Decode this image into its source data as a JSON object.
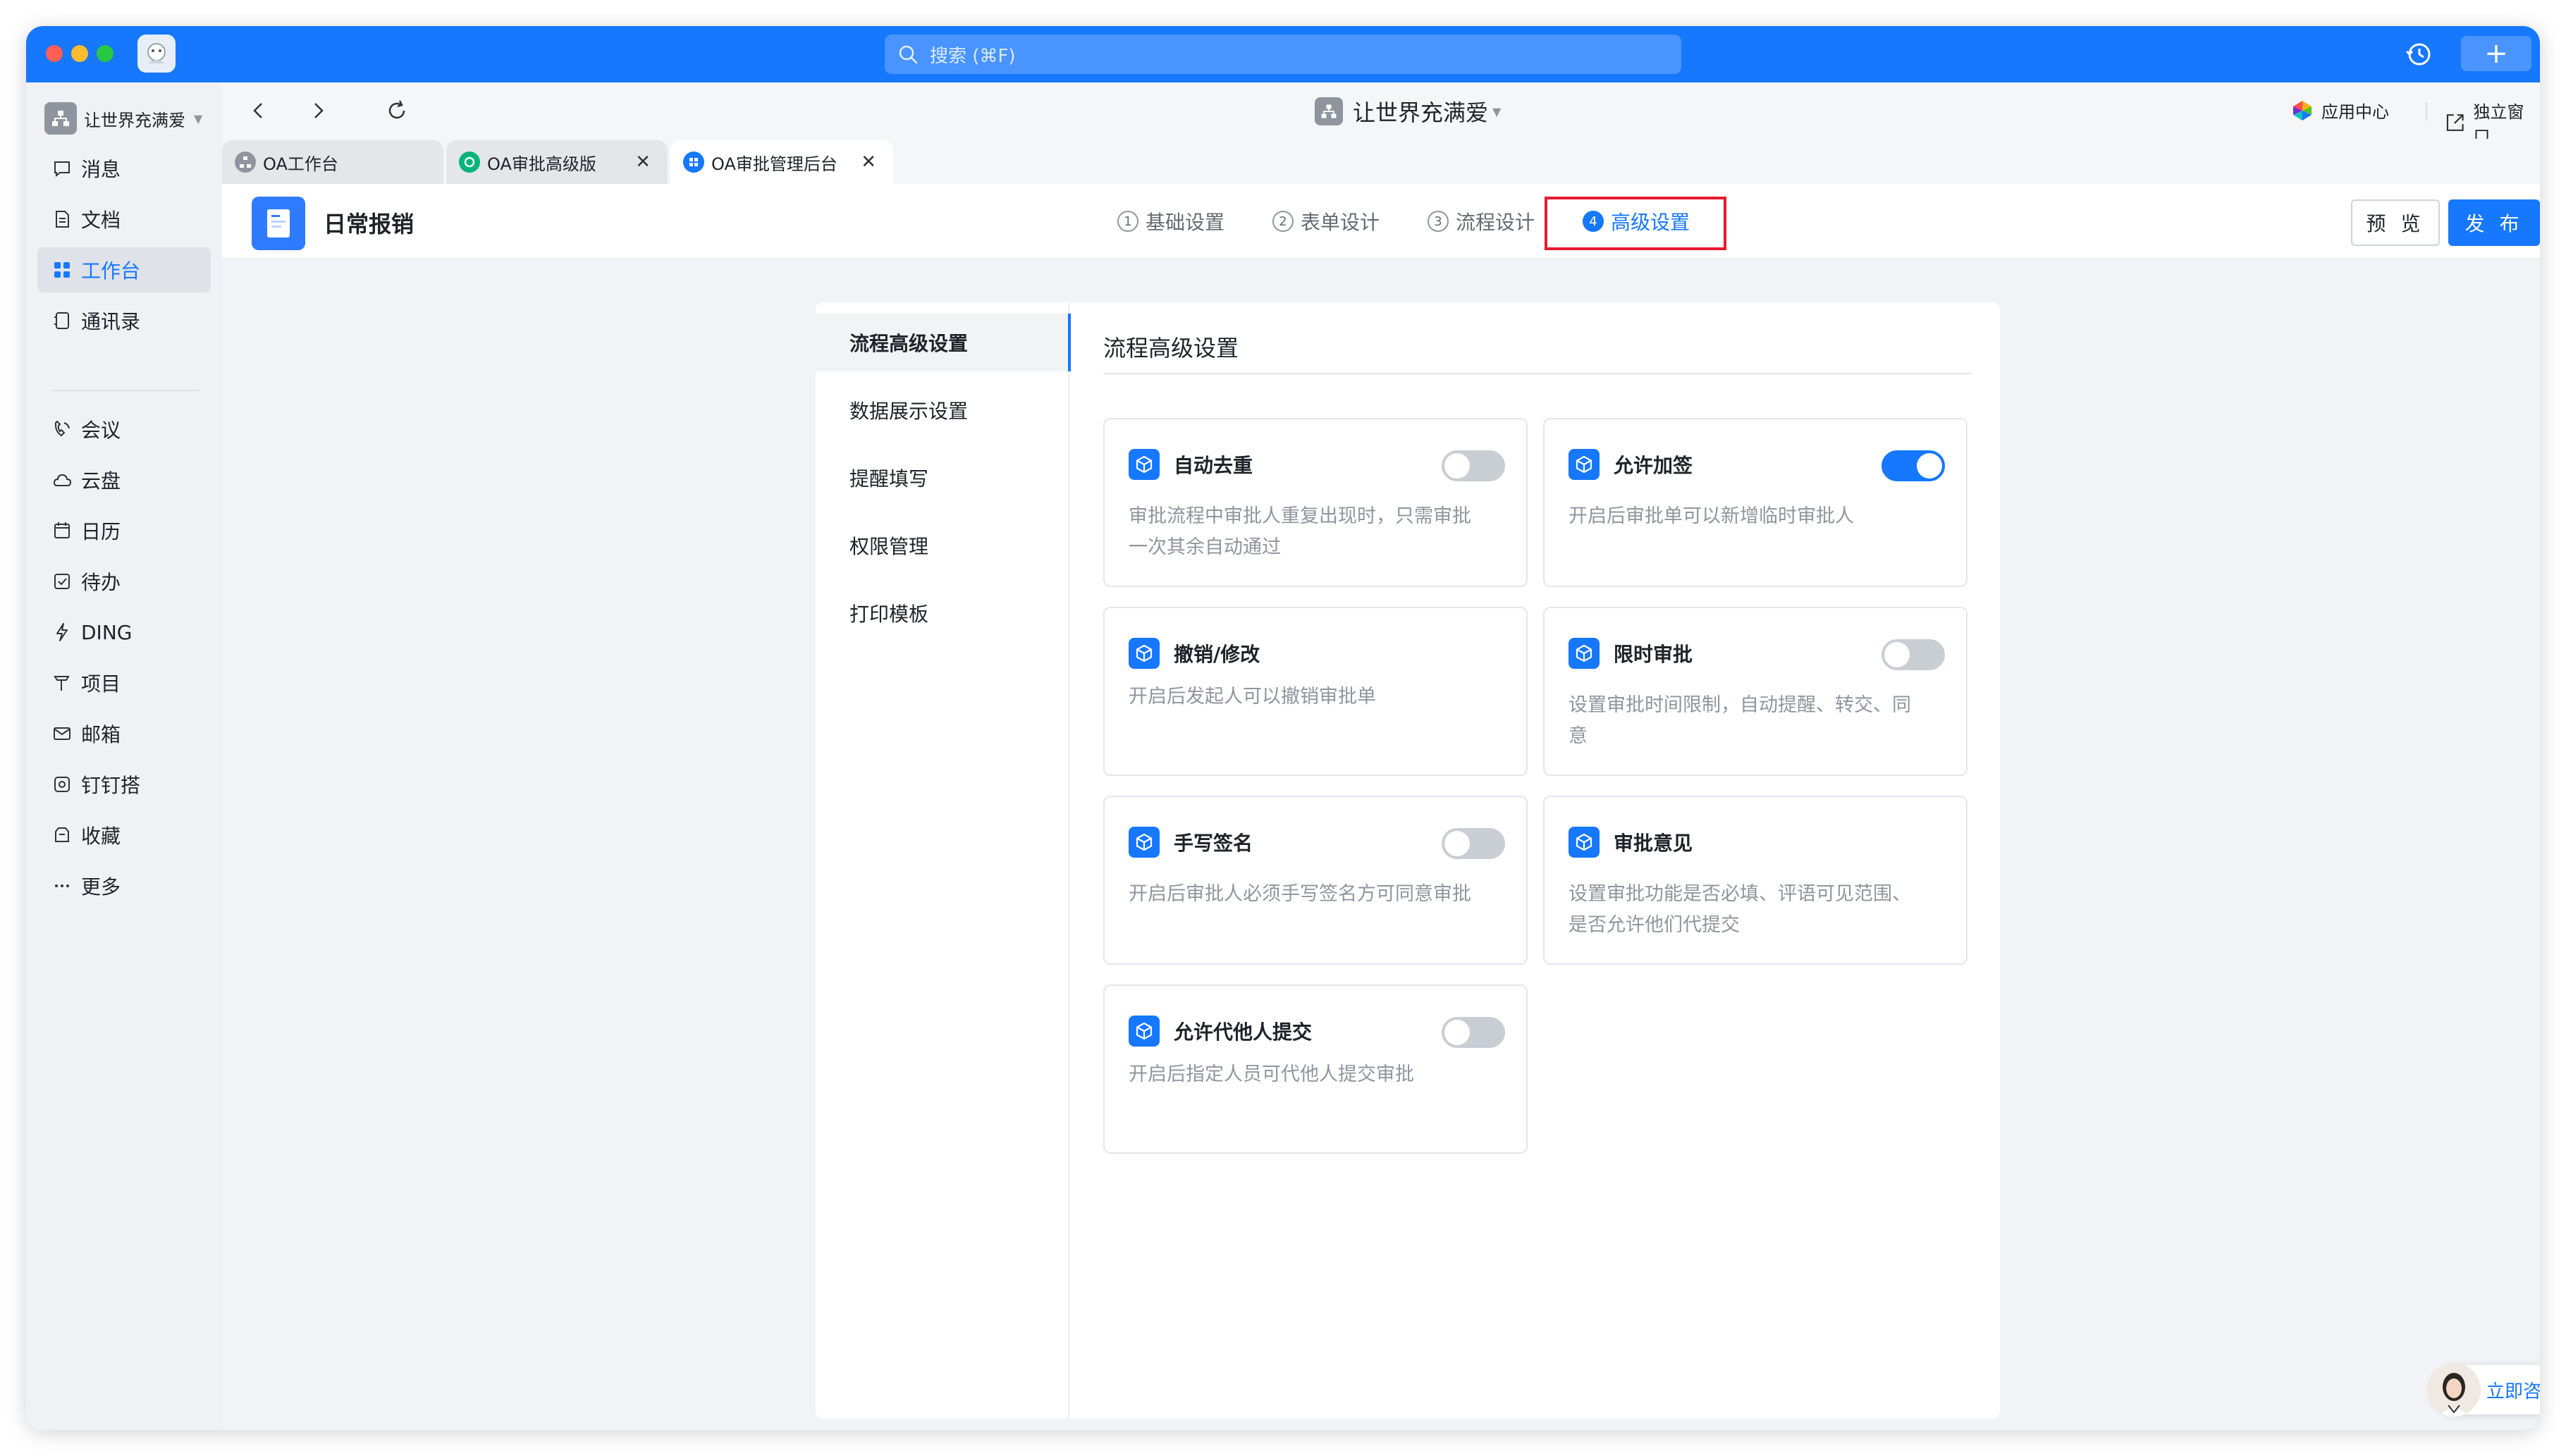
{
  "search": {
    "placeholder": "搜索 (⌘F)"
  },
  "sidebar": {
    "org_name": "让世界充满爱",
    "items": [
      {
        "label": "消息",
        "icon": "message-icon"
      },
      {
        "label": "文档",
        "icon": "document-icon"
      },
      {
        "label": "工作台",
        "icon": "workbench-icon",
        "active": true
      },
      {
        "label": "通讯录",
        "icon": "contacts-icon"
      },
      {
        "label": "会议",
        "icon": "meeting-icon"
      },
      {
        "label": "云盘",
        "icon": "cloud-icon"
      },
      {
        "label": "日历",
        "icon": "calendar-icon"
      },
      {
        "label": "待办",
        "icon": "todo-icon"
      },
      {
        "label": "DING",
        "icon": "ding-icon"
      },
      {
        "label": "项目",
        "icon": "project-icon"
      },
      {
        "label": "邮箱",
        "icon": "mail-icon"
      },
      {
        "label": "钉钉搭",
        "icon": "app-builder-icon"
      },
      {
        "label": "收藏",
        "icon": "favorites-icon"
      },
      {
        "label": "更多",
        "icon": "more-icon"
      }
    ]
  },
  "toolbar": {
    "org_title": "让世界充满爱",
    "app_center": "应用中心",
    "float_window": "独立窗口"
  },
  "tabs": [
    {
      "label": "OA工作台",
      "icon": "org-icon",
      "active": false
    },
    {
      "label": "OA审批高级版",
      "icon": "approval-icon",
      "active": false
    },
    {
      "label": "OA审批管理后台",
      "icon": "grid-app-icon",
      "active": true
    }
  ],
  "header": {
    "form_title": "日常报销",
    "steps": [
      {
        "num": "1",
        "label": "基础设置"
      },
      {
        "num": "2",
        "label": "表单设计"
      },
      {
        "num": "3",
        "label": "流程设计"
      },
      {
        "num": "4",
        "label": "高级设置",
        "active": true
      }
    ],
    "preview": "预 览",
    "publish": "发 布"
  },
  "settings": {
    "menu": [
      "流程高级设置",
      "数据展示设置",
      "提醒填写",
      "权限管理",
      "打印模板"
    ],
    "active_menu": "流程高级设置",
    "section_title": "流程高级设置",
    "cards": [
      {
        "title": "自动去重",
        "desc": "审批流程中审批人重复出现时，只需审批一次其余自动通过",
        "toggle": "off"
      },
      {
        "title": "允许加签",
        "desc": "开启后审批单可以新增临时审批人",
        "toggle": "on"
      },
      {
        "title": "撤销/修改",
        "desc": "开启后发起人可以撤销审批单",
        "toggle": "none"
      },
      {
        "title": "限时审批",
        "desc": "设置审批时间限制，自动提醒、转交、同意",
        "toggle": "off"
      },
      {
        "title": "手写签名",
        "desc": "开启后审批人必须手写签名方可同意审批",
        "toggle": "off"
      },
      {
        "title": "审批意见",
        "desc": "设置审批功能是否必填、评语可见范围、是否允许他们代提交",
        "toggle": "none"
      },
      {
        "title": "允许代他人提交",
        "desc": "开启后指定人员可代他人提交审批",
        "toggle": "off"
      }
    ]
  },
  "consult": {
    "label": "立即咨询"
  },
  "colors": {
    "brand": "#1677ff",
    "highlight": "#e8192c"
  }
}
